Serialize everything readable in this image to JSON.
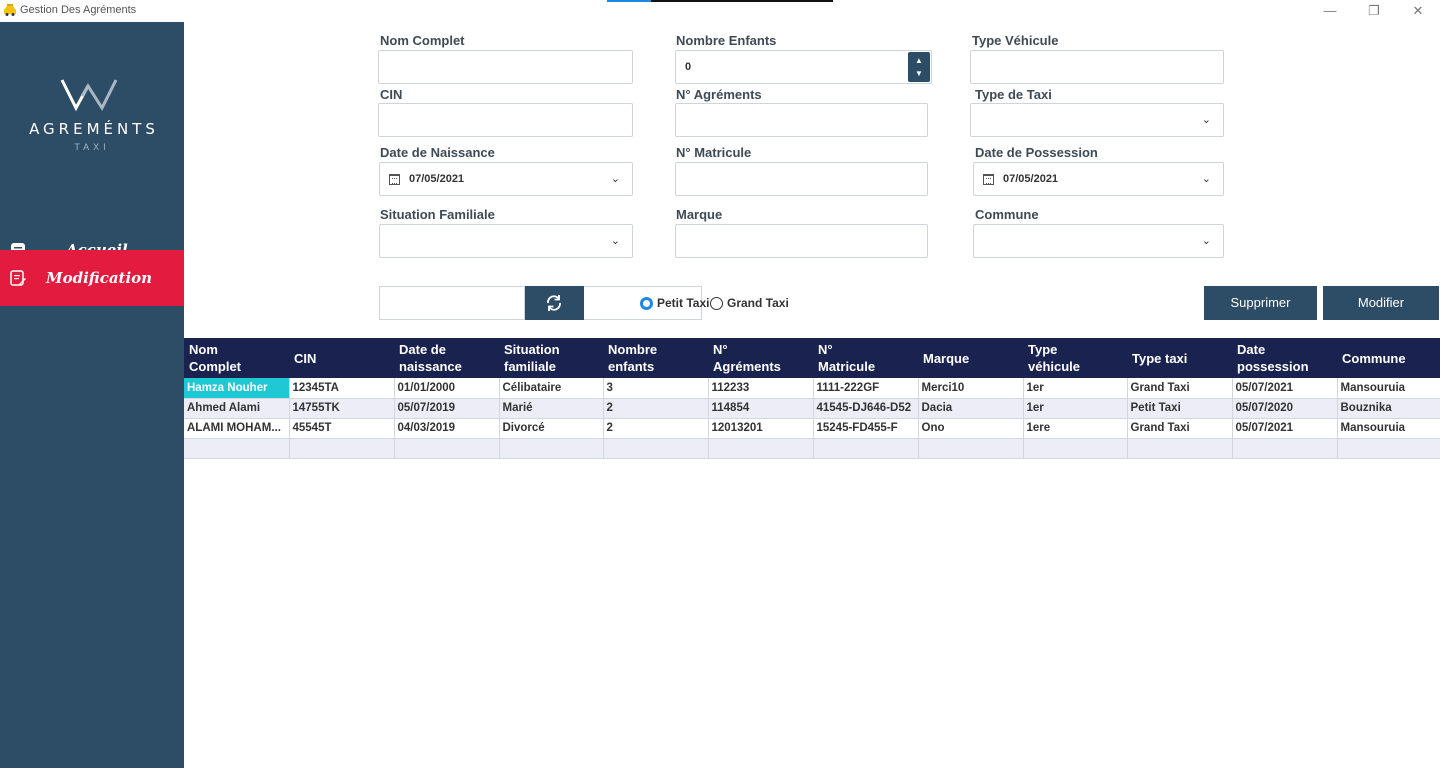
{
  "window": {
    "title": "Gestion Des Agréments"
  },
  "brand": {
    "name": "AGREMÉNTS",
    "subtitle": "TAXI"
  },
  "nav": {
    "home": "Accueil",
    "modification": "Modification"
  },
  "form": {
    "nom_complet": {
      "label": "Nom Complet",
      "value": ""
    },
    "nombre_enfants": {
      "label": "Nombre Enfants",
      "value": "0"
    },
    "type_vehicule": {
      "label": "Type Véhicule",
      "value": ""
    },
    "cin": {
      "label": "CIN",
      "value": ""
    },
    "n_agrements": {
      "label": "N° Agréments",
      "value": ""
    },
    "type_taxi": {
      "label": "Type de Taxi",
      "value": ""
    },
    "date_naissance": {
      "label": "Date de Naissance",
      "value": "07/05/2021"
    },
    "n_matricule": {
      "label": "N° Matricule",
      "value": ""
    },
    "date_possession": {
      "label": "Date de Possession",
      "value": "07/05/2021"
    },
    "situation": {
      "label": "Situation Familiale",
      "value": ""
    },
    "marque": {
      "label": "Marque",
      "value": ""
    },
    "commune": {
      "label": "Commune",
      "value": ""
    }
  },
  "filter": {
    "search_value": "",
    "radio_petit": "Petit Taxi",
    "radio_grand": "Grand Taxi",
    "selected": "Petit Taxi"
  },
  "actions": {
    "delete": "Supprimer",
    "modify": "Modifier"
  },
  "table": {
    "headers": [
      [
        "Nom",
        "Complet"
      ],
      [
        "CIN",
        ""
      ],
      [
        "Date de",
        "naissance"
      ],
      [
        "Situation",
        "familiale"
      ],
      [
        "Nombre",
        "enfants"
      ],
      [
        "N°",
        "Agréments"
      ],
      [
        "N°",
        "Matricule"
      ],
      [
        "Marque",
        ""
      ],
      [
        "Type",
        "véhicule"
      ],
      [
        "Type taxi",
        ""
      ],
      [
        "Date",
        "possession"
      ],
      [
        "Commune",
        ""
      ]
    ],
    "rows": [
      [
        "Hamza Nouher",
        "12345TA",
        "01/01/2000",
        "Célibataire",
        "3",
        "112233",
        "1111-222GF",
        "Merci10",
        "1er",
        "Grand Taxi",
        "05/07/2021",
        "Mansouruia"
      ],
      [
        "Ahmed Alami",
        "14755TK",
        "05/07/2019",
        "Marié",
        "2",
        "114854",
        "41545-DJ646-D52",
        "Dacia",
        "1er",
        "Petit Taxi",
        "05/07/2020",
        "Bouznika"
      ],
      [
        "ALAMI MOHAM...",
        "45545T",
        "04/03/2019",
        "Divorcé",
        "2",
        "12013201",
        "15245-FD455-F",
        "Ono",
        "1ere",
        "Grand Taxi",
        "05/07/2021",
        "Mansouruia"
      ],
      [
        "",
        "",
        "",
        "",
        "",
        "",
        "",
        "",
        "",
        "",
        "",
        ""
      ]
    ]
  },
  "colors": {
    "sidebar": "#2d4c66",
    "active_nav": "#e31b3f",
    "header": "#1a2350",
    "selection": "#1fc9d3"
  }
}
